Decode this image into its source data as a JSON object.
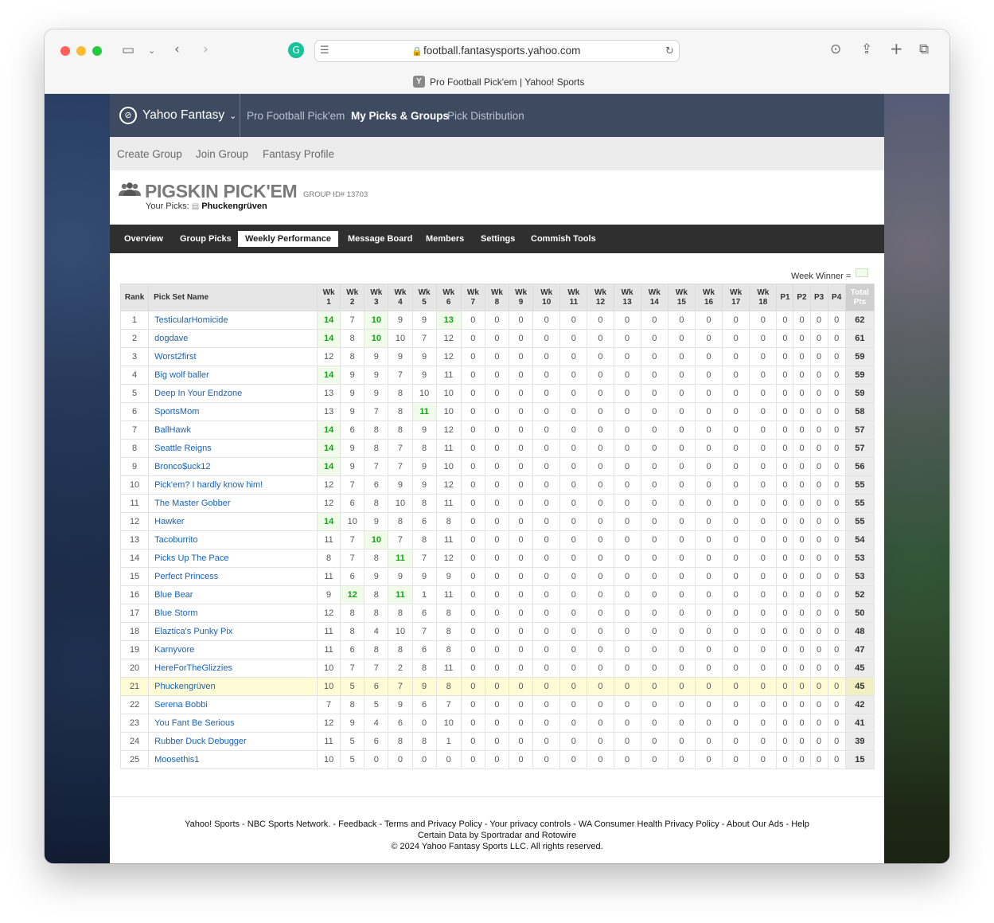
{
  "browser": {
    "url": "football.fantasysports.yahoo.com",
    "tab_title": "Pro Football Pick'em | Yahoo! Sports",
    "favicon_letter": "Y"
  },
  "topnav": {
    "brand": "Yahoo Fantasy",
    "links": [
      "Pro Football Pick'em",
      "My Picks & Groups",
      "Pick Distribution"
    ],
    "active_link": "My Picks & Groups"
  },
  "subnav": [
    "Create Group",
    "Join Group",
    "Fantasy Profile"
  ],
  "group": {
    "title": "PIGSKIN PICK'EM",
    "id_label": "GROUP ID# 13703",
    "your_picks_label": "Your Picks:",
    "your_picks_name": "Phuckengrüven"
  },
  "tabs": [
    "Overview",
    "Group Picks",
    "Weekly Performance",
    "Message Board",
    "Members",
    "Settings",
    "Commish Tools"
  ],
  "active_tab": "Weekly Performance",
  "week_winner_label": "Week Winner =",
  "table": {
    "headers": {
      "rank": "Rank",
      "name": "Pick Set Name",
      "weeks": [
        "Wk 1",
        "Wk 2",
        "Wk 3",
        "Wk 4",
        "Wk 5",
        "Wk 6",
        "Wk 7",
        "Wk 8",
        "Wk 9",
        "Wk 10",
        "Wk 11",
        "Wk 12",
        "Wk 13",
        "Wk 14",
        "Wk 15",
        "Wk 16",
        "Wk 17",
        "Wk 18"
      ],
      "playoffs": [
        "P1",
        "P2",
        "P3",
        "P4"
      ],
      "total": "Total Pts"
    },
    "rows": [
      {
        "rank": "1",
        "name": "TesticularHomicide",
        "weeks": [
          "14",
          "7",
          "10",
          "9",
          "9",
          "13"
        ],
        "winners": [
          0,
          2,
          5
        ],
        "total": "62"
      },
      {
        "rank": "2",
        "name": "dogdave",
        "weeks": [
          "14",
          "8",
          "10",
          "10",
          "7",
          "12"
        ],
        "winners": [
          0,
          2
        ],
        "total": "61"
      },
      {
        "rank": "3",
        "name": "Worst2first",
        "weeks": [
          "12",
          "8",
          "9",
          "9",
          "9",
          "12"
        ],
        "winners": [],
        "total": "59"
      },
      {
        "rank": "4",
        "name": "Big wolf baller",
        "weeks": [
          "14",
          "9",
          "9",
          "7",
          "9",
          "11"
        ],
        "winners": [
          0
        ],
        "total": "59"
      },
      {
        "rank": "5",
        "name": "Deep In Your Endzone",
        "weeks": [
          "13",
          "9",
          "9",
          "8",
          "10",
          "10"
        ],
        "winners": [],
        "total": "59"
      },
      {
        "rank": "6",
        "name": "SportsMom",
        "weeks": [
          "13",
          "9",
          "7",
          "8",
          "11",
          "10"
        ],
        "winners": [
          4
        ],
        "total": "58"
      },
      {
        "rank": "7",
        "name": "BallHawk",
        "weeks": [
          "14",
          "6",
          "8",
          "8",
          "9",
          "12"
        ],
        "winners": [
          0
        ],
        "total": "57"
      },
      {
        "rank": "8",
        "name": "Seattle Reigns",
        "weeks": [
          "14",
          "9",
          "8",
          "7",
          "8",
          "11"
        ],
        "winners": [
          0
        ],
        "total": "57"
      },
      {
        "rank": "9",
        "name": "Bronco$uck12",
        "weeks": [
          "14",
          "9",
          "7",
          "7",
          "9",
          "10"
        ],
        "winners": [
          0
        ],
        "total": "56"
      },
      {
        "rank": "10",
        "name": "Pick'em? I hardly know him!",
        "weeks": [
          "12",
          "7",
          "6",
          "9",
          "9",
          "12"
        ],
        "winners": [],
        "total": "55"
      },
      {
        "rank": "11",
        "name": "The Master Gobber",
        "weeks": [
          "12",
          "6",
          "8",
          "10",
          "8",
          "11"
        ],
        "winners": [],
        "total": "55"
      },
      {
        "rank": "12",
        "name": "Hawker",
        "weeks": [
          "14",
          "10",
          "9",
          "8",
          "6",
          "8"
        ],
        "winners": [
          0
        ],
        "total": "55"
      },
      {
        "rank": "13",
        "name": "Tacoburrito",
        "weeks": [
          "11",
          "7",
          "10",
          "7",
          "8",
          "11"
        ],
        "winners": [
          2
        ],
        "total": "54"
      },
      {
        "rank": "14",
        "name": "Picks Up The Pace",
        "weeks": [
          "8",
          "7",
          "8",
          "11",
          "7",
          "12"
        ],
        "winners": [
          3
        ],
        "total": "53"
      },
      {
        "rank": "15",
        "name": "Perfect Princess",
        "weeks": [
          "11",
          "6",
          "9",
          "9",
          "9",
          "9"
        ],
        "winners": [],
        "total": "53"
      },
      {
        "rank": "16",
        "name": "Blue Bear",
        "weeks": [
          "9",
          "12",
          "8",
          "11",
          "1",
          "11"
        ],
        "winners": [
          1,
          3
        ],
        "total": "52"
      },
      {
        "rank": "17",
        "name": "Blue Storm",
        "weeks": [
          "12",
          "8",
          "8",
          "8",
          "6",
          "8"
        ],
        "winners": [],
        "total": "50"
      },
      {
        "rank": "18",
        "name": "Elaztica's Punky Pix",
        "weeks": [
          "11",
          "8",
          "4",
          "10",
          "7",
          "8"
        ],
        "winners": [],
        "total": "48"
      },
      {
        "rank": "19",
        "name": "Karnyvore",
        "weeks": [
          "11",
          "6",
          "8",
          "8",
          "6",
          "8"
        ],
        "winners": [],
        "total": "47"
      },
      {
        "rank": "20",
        "name": "HereForTheGlizzies",
        "weeks": [
          "10",
          "7",
          "7",
          "2",
          "8",
          "11"
        ],
        "winners": [],
        "total": "45"
      },
      {
        "rank": "21",
        "name": "Phuckengrüven",
        "weeks": [
          "10",
          "5",
          "6",
          "7",
          "9",
          "8"
        ],
        "winners": [],
        "total": "45",
        "me": true
      },
      {
        "rank": "22",
        "name": "Serena Bobbi",
        "weeks": [
          "7",
          "8",
          "5",
          "9",
          "6",
          "7"
        ],
        "winners": [],
        "total": "42"
      },
      {
        "rank": "23",
        "name": "You Fant Be Serious",
        "weeks": [
          "12",
          "9",
          "4",
          "6",
          "0",
          "10"
        ],
        "winners": [],
        "total": "41"
      },
      {
        "rank": "24",
        "name": "Rubber Duck Debugger",
        "weeks": [
          "11",
          "5",
          "6",
          "8",
          "8",
          "1"
        ],
        "winners": [],
        "total": "39"
      },
      {
        "rank": "25",
        "name": "Moosethis1",
        "weeks": [
          "10",
          "5",
          "0",
          "0",
          "0",
          "0"
        ],
        "winners": [],
        "total": "15"
      }
    ],
    "empty_value": "0"
  },
  "footer": {
    "line1": "Yahoo! Sports - NBC Sports Network. - Feedback - Terms and Privacy Policy - Your privacy controls - WA Consumer Health Privacy Policy  - About Our Ads - Help",
    "line2": "Certain Data by Sportradar and Rotowire",
    "line3": "© 2024 Yahoo Fantasy Sports LLC. All rights reserved."
  },
  "colors": {
    "win_green": "#17a317",
    "link_blue": "#1a62b5",
    "tab_bar": "#2f2f2f",
    "highlight_row": "#fffbd4"
  }
}
